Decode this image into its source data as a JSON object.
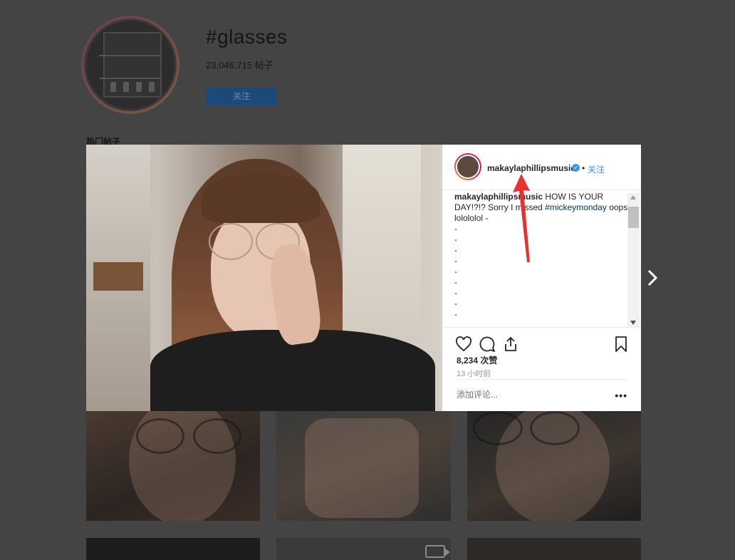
{
  "tag_page": {
    "title": "#glasses",
    "post_count": "23,046,715 帖子",
    "follow_label": "关注",
    "section_label": "热门帖子"
  },
  "post": {
    "username": "makaylaphillipsmusic",
    "follow_label": "关注",
    "separator": "•",
    "caption_user": "makaylaphillipsmusic",
    "caption_text_1": " HOW IS YOUR DAY!?!? Sorry I missed ",
    "caption_hashtag": "#mickeymonday",
    "caption_text_2": " oops lolololol -",
    "caption_dashes": [
      "-",
      "-",
      "-",
      "-",
      "-",
      "-",
      "-",
      "-",
      "-"
    ],
    "likes": "8,234 次赞",
    "time_ago": "13 小时前",
    "comment_placeholder": "添加评论...",
    "more_label": "•••"
  },
  "colors": {
    "link_blue": "#3897f0",
    "hashtag_blue": "#003569",
    "annotation_red": "#e8312c",
    "overlay": "#444444"
  },
  "icons": [
    "heart-icon",
    "comment-icon",
    "share-icon",
    "bookmark-icon",
    "verified-icon",
    "chevron-right-icon",
    "more-icon"
  ]
}
